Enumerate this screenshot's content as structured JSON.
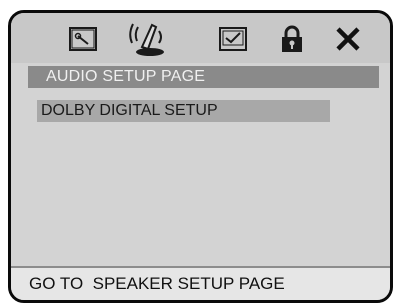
{
  "tabs": [
    {
      "icon": "wrench-icon",
      "label": "General setup"
    },
    {
      "icon": "speaker-icon",
      "label": "Audio setup"
    },
    {
      "icon": "checkmark-icon",
      "label": "Preference"
    },
    {
      "icon": "lock-icon",
      "label": "Password"
    },
    {
      "icon": "close-icon",
      "label": "Exit"
    }
  ],
  "header": {
    "title": "AUDIO SETUP PAGE"
  },
  "menu": {
    "items": [
      {
        "label": "DOLBY DIGITAL SETUP",
        "selected": true
      }
    ]
  },
  "status": {
    "text": "GO TO  SPEAKER SETUP PAGE"
  },
  "colors": {
    "frame": "#d3d3d3",
    "header": "#8a8a8a",
    "highlight": "#a8a8a8",
    "statusbar": "#e6e6e6",
    "border": "#0a0a0a"
  }
}
